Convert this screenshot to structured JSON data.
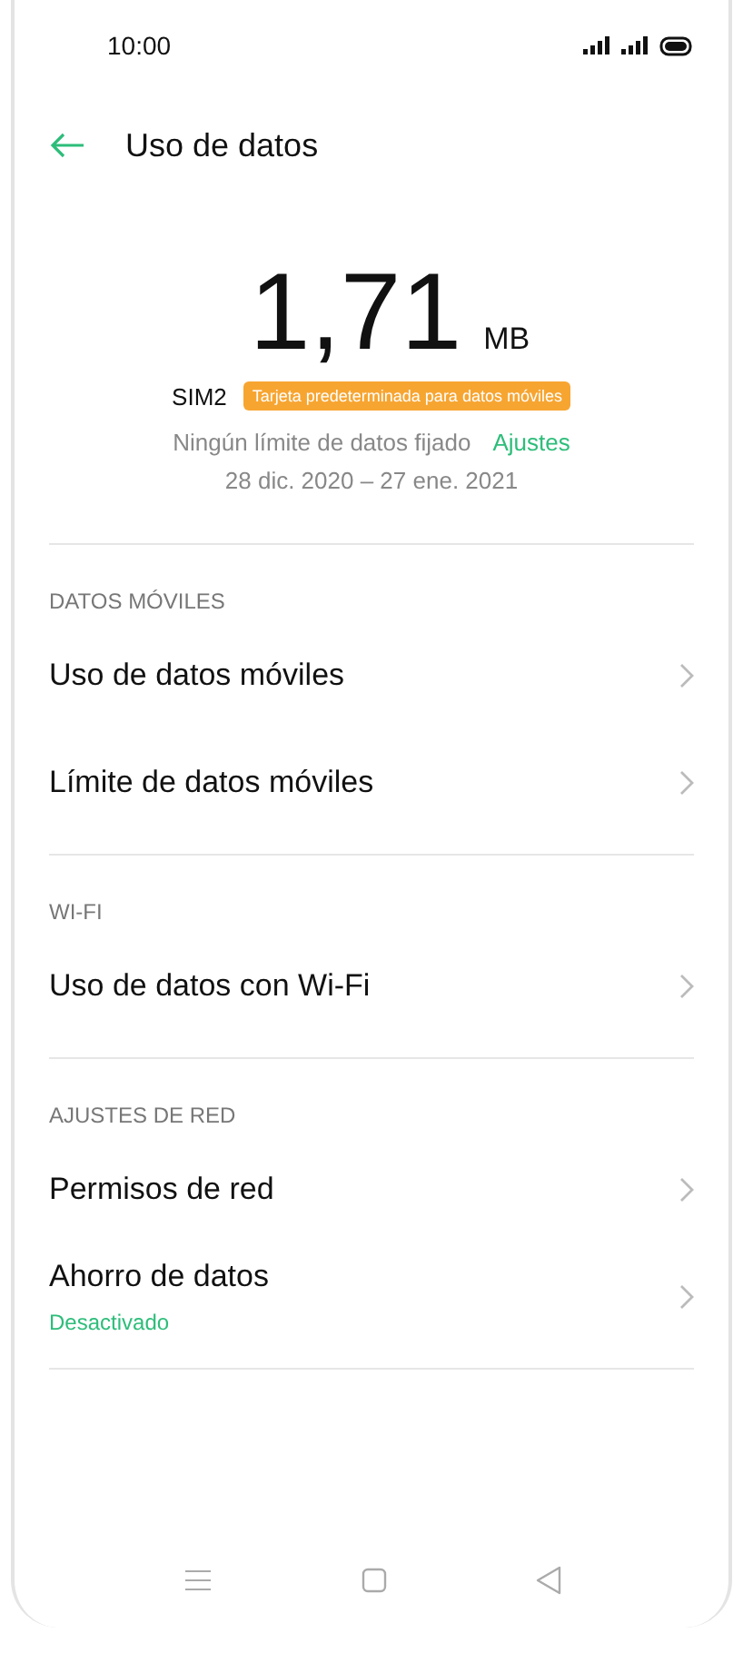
{
  "status_bar": {
    "time": "10:00"
  },
  "header": {
    "title": "Uso de datos"
  },
  "usage": {
    "amount": "1,71",
    "unit": "MB",
    "sim": "SIM2",
    "badge": "Tarjeta predeterminada para datos móviles",
    "limit_text": "Ningún límite de datos fijado",
    "limit_link": "Ajustes",
    "period": "28 dic. 2020 – 27 ene. 2021"
  },
  "sections": [
    {
      "title": "DATOS MÓVILES",
      "items": [
        {
          "label": "Uso de datos móviles"
        },
        {
          "label": "Límite de datos móviles"
        }
      ]
    },
    {
      "title": "WI-FI",
      "items": [
        {
          "label": "Uso de datos con Wi-Fi"
        }
      ]
    },
    {
      "title": "AJUSTES DE RED",
      "items": [
        {
          "label": "Permisos de red"
        },
        {
          "label": "Ahorro de datos",
          "subtitle": "Desactivado"
        }
      ]
    }
  ]
}
